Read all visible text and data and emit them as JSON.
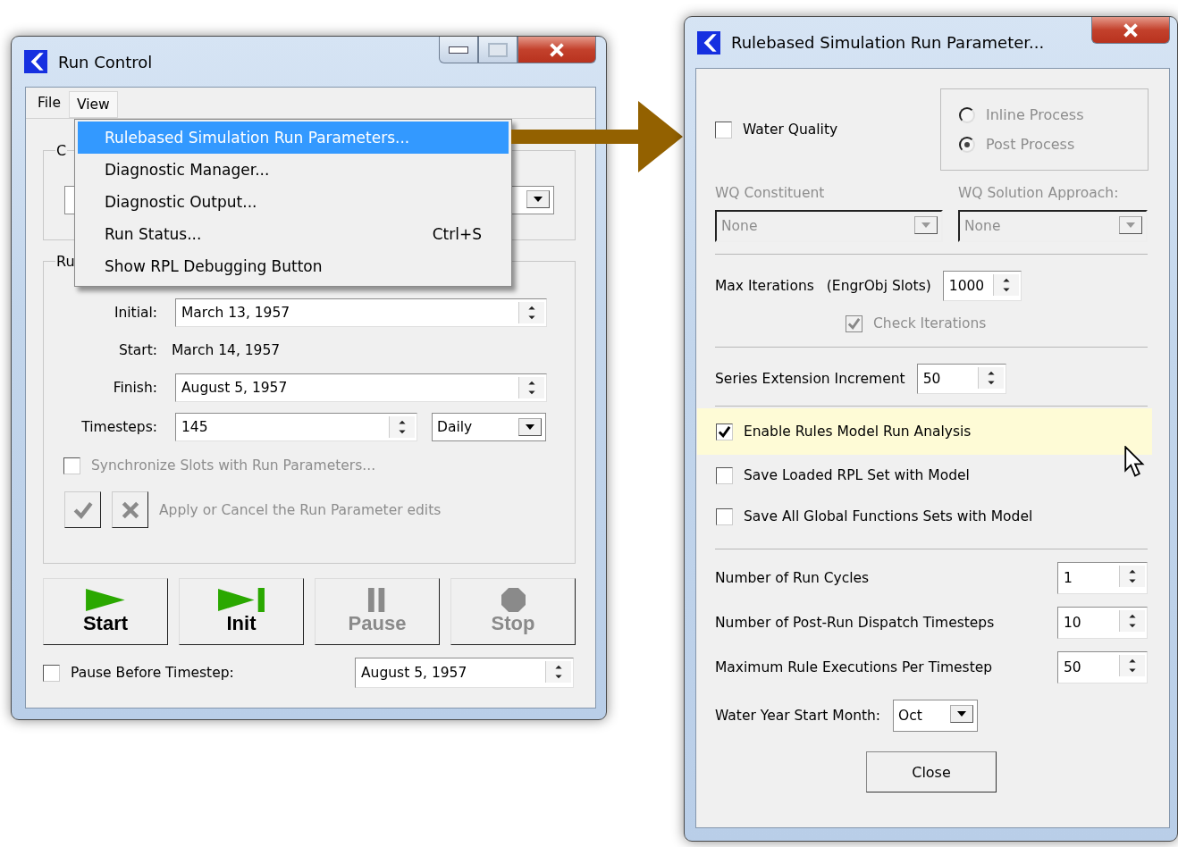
{
  "run_control": {
    "title": "Run Control",
    "menu_bar": [
      {
        "label": "File",
        "selected": false
      },
      {
        "label": "View",
        "selected": true
      }
    ],
    "view_menu": [
      {
        "label": "Rulebased Simulation Run Parameters...",
        "selected": true
      },
      {
        "label": "Diagnostic Manager...",
        "selected": false
      },
      {
        "label": "Diagnostic Output...",
        "selected": false
      },
      {
        "label": "Run Status...",
        "shortcut": "Ctrl+S",
        "selected": false
      },
      {
        "label": "Show RPL Debugging Button",
        "selected": false
      }
    ],
    "group_1": {
      "legend": "C"
    },
    "group_2": {
      "legend": "Ru",
      "initial": {
        "label": "Initial:",
        "value": "March 13, 1957"
      },
      "start": {
        "label": "Start:",
        "value": "March 14, 1957"
      },
      "finish": {
        "label": "Finish:",
        "value": "August 5, 1957"
      },
      "timesteps": {
        "label": "Timesteps:",
        "value": "145",
        "unit": "Daily"
      },
      "synchronize": {
        "label": "Synchronize Slots with Run Parameters...",
        "checked": false,
        "disabled": true
      },
      "apply_hint": "Apply or Cancel the Run Parameter edits"
    },
    "run_buttons": [
      {
        "kind": "start",
        "label": "Start",
        "disabled": false
      },
      {
        "kind": "init",
        "label": "Init",
        "disabled": false
      },
      {
        "kind": "pause",
        "label": "Pause",
        "disabled": true
      },
      {
        "kind": "stop",
        "label": "Stop",
        "disabled": true
      }
    ],
    "pause_before": {
      "label": "Pause Before Timestep:",
      "checked": false,
      "value": "August 5, 1957"
    }
  },
  "run_parameters": {
    "title": "Rulebased Simulation Run Parameter...",
    "water_quality": {
      "label": "Water Quality",
      "checked": false
    },
    "process": [
      {
        "label": "Inline Process",
        "selected": false
      },
      {
        "label": "Post Process",
        "selected": true
      }
    ],
    "process_disabled": true,
    "wq_constituent": {
      "label": "WQ Constituent",
      "value": "None",
      "disabled": true
    },
    "wq_solution": {
      "label": "WQ Solution Approach:",
      "value": "None",
      "disabled": true
    },
    "max_iterations": {
      "label": "Max Iterations",
      "note": "(EngrObj Slots)",
      "value": "1000"
    },
    "check_iterations": {
      "label": "Check Iterations",
      "checked": true,
      "disabled": true
    },
    "series_extension": {
      "label": "Series Extension Increment",
      "value": "50"
    },
    "options": [
      {
        "label": "Enable Rules Model Run Analysis",
        "checked": true,
        "highlighted": true
      },
      {
        "label": "Save Loaded RPL Set with Model",
        "checked": false,
        "highlighted": false
      },
      {
        "label": "Save All Global Functions Sets with Model",
        "checked": false,
        "highlighted": false
      }
    ],
    "counts": [
      {
        "label": "Number of Run Cycles",
        "value": "1"
      },
      {
        "label": "Number of Post-Run Dispatch Timesteps",
        "value": "10"
      },
      {
        "label": "Maximum Rule Executions Per Timestep",
        "value": "50"
      }
    ],
    "water_year": {
      "label": "Water Year Start Month:",
      "value": "Oct"
    },
    "close": "Close"
  }
}
